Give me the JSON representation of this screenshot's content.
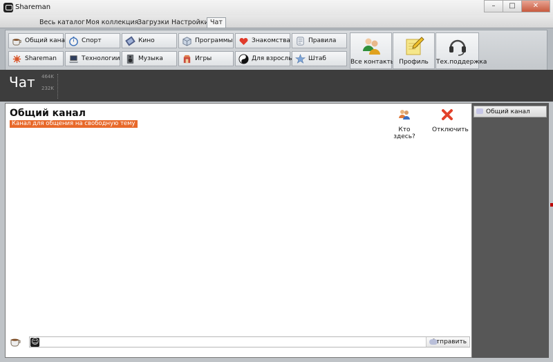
{
  "window": {
    "title": "Shareman",
    "buttons": {
      "minimize": "–",
      "maximize": "□",
      "close": "✕"
    }
  },
  "tabs": [
    {
      "label": "Весь каталог"
    },
    {
      "label": "Моя коллекция"
    },
    {
      "label": "Загрузки"
    },
    {
      "label": "Настройки"
    },
    {
      "label": "Чат",
      "active": true
    }
  ],
  "toolbar": {
    "row1": [
      {
        "label": "Общий канал",
        "icon": "coffee-cup-icon"
      },
      {
        "label": "Спорт",
        "icon": "stopwatch-icon"
      },
      {
        "label": "Кино",
        "icon": "film-icon"
      },
      {
        "label": "Программы",
        "icon": "software-box-icon"
      },
      {
        "label": "Знакомства",
        "icon": "heart-icon"
      },
      {
        "label": "Правила",
        "icon": "scroll-icon"
      }
    ],
    "row2": [
      {
        "label": "Shareman",
        "icon": "shareman-logo-icon"
      },
      {
        "label": "Технологии",
        "icon": "laptop-icon"
      },
      {
        "label": "Музыка",
        "icon": "speaker-icon"
      },
      {
        "label": "Игры",
        "icon": "game-icon"
      },
      {
        "label": "Для взрослых",
        "icon": "yin-yang-icon"
      },
      {
        "label": "Штаб",
        "icon": "star-icon"
      }
    ],
    "big": [
      {
        "label": "Все контакты",
        "icon": "contacts-icon"
      },
      {
        "label": "Профиль",
        "icon": "notepad-pencil-icon"
      },
      {
        "label": "Тех.поддержка",
        "icon": "headset-icon"
      }
    ]
  },
  "status": {
    "section_title": "Чат",
    "traffic_high": "464K",
    "traffic_low": "232K"
  },
  "channel": {
    "title": "Общий канал",
    "description": "Канал для общения на свободную тему",
    "whos_here": "Кто здесь?",
    "disconnect": "Отключить"
  },
  "input": {
    "value": "",
    "placeholder": "",
    "send_label": "Отправить"
  },
  "sidebar": {
    "items": [
      {
        "label": "Общий канал"
      }
    ]
  },
  "colors": {
    "accent_orange": "#e8692a",
    "dark_band": "#3d3d3d",
    "sidebar": "#575757"
  }
}
